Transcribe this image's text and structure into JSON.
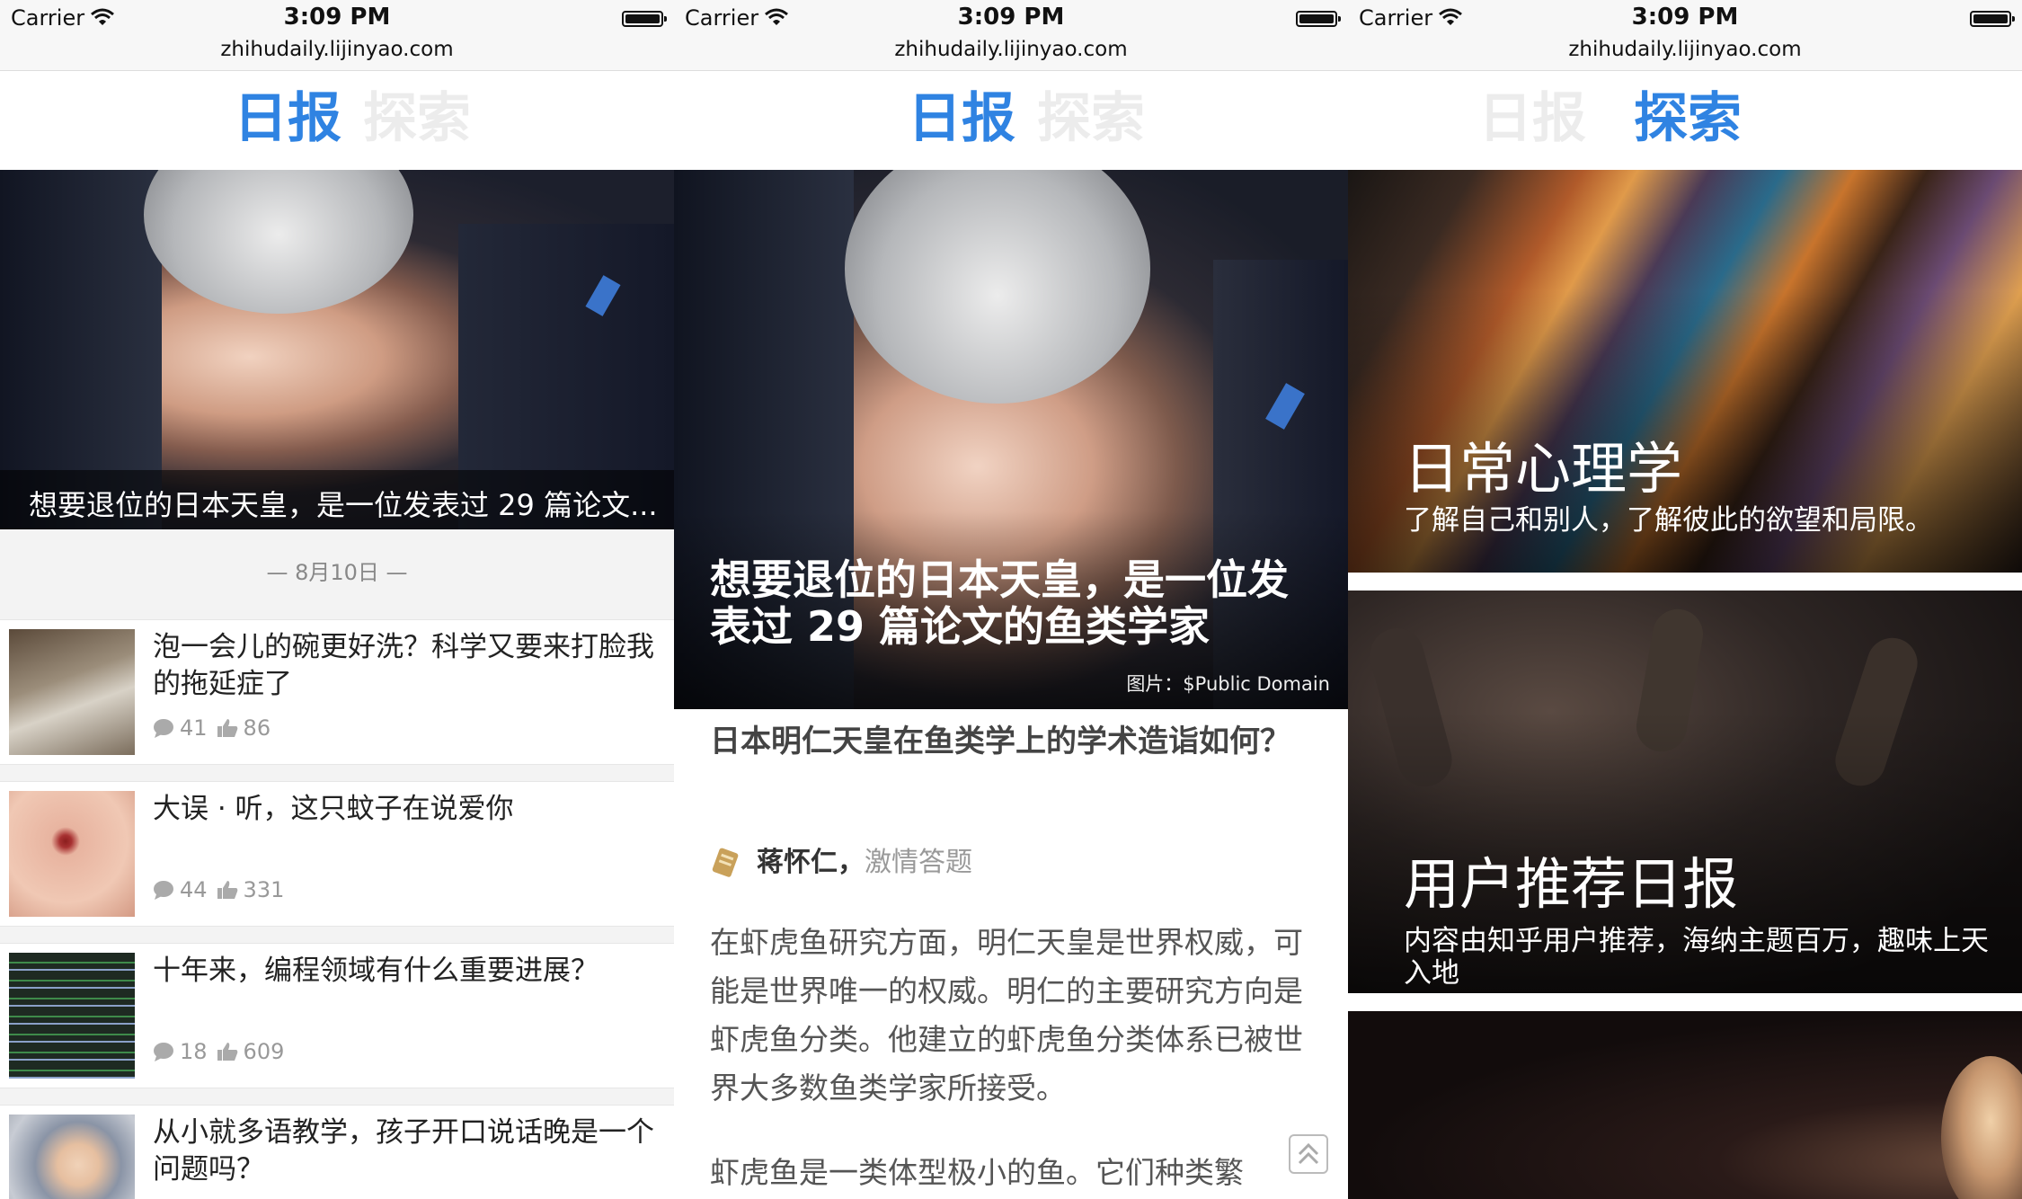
{
  "status": {
    "carrier": "Carrier",
    "time": "3:09 PM",
    "url": "zhihudaily.lijinyao.com"
  },
  "tabs": {
    "daily": "日报",
    "explore": "探索"
  },
  "screen1": {
    "hero_caption": "想要退位的日本天皇，是一位发表过 29 篇论文...",
    "date_header": "—  8月10日  —",
    "stories": [
      {
        "title": "泡一会儿的碗更好洗？科学又要来打脸我的拖延症了",
        "comments": "41",
        "likes": "86"
      },
      {
        "title": "大误 · 听，这只蚊子在说爱你",
        "comments": "44",
        "likes": "331"
      },
      {
        "title": "十年来，编程领域有什么重要进展？",
        "comments": "18",
        "likes": "609"
      },
      {
        "title": "从小就多语教学，孩子开口说话晚是一个问题吗？"
      }
    ]
  },
  "screen2": {
    "hero_title": "想要退位的日本天皇，是一位发表过 29 篇论文的鱼类学家",
    "hero_credit": "图片：$Public Domain",
    "question": "日本明仁天皇在鱼类学上的学术造诣如何？",
    "author_name": "蒋怀仁，",
    "author_bio": "激情答题",
    "paragraphs": [
      "在虾虎鱼研究方面，明仁天皇是世界权威，可能是世界唯一的权威。明仁的主要研究方向是虾虎鱼分类。他建立的虾虎鱼分类体系已被世界大多数鱼类学家所接受。",
      "虾虎鱼是一类体型极小的鱼。它们种类繁"
    ]
  },
  "screen3": {
    "cards": [
      {
        "title": "日常心理学",
        "subtitle": "了解自己和别人，了解彼此的欲望和局限。"
      },
      {
        "title": "用户推荐日报",
        "subtitle": "内容由知乎用户推荐，海纳主题百万，趣味上天入地"
      }
    ]
  },
  "colors": {
    "accent": "#2f83e2",
    "inactive_tab": "#ececec"
  }
}
